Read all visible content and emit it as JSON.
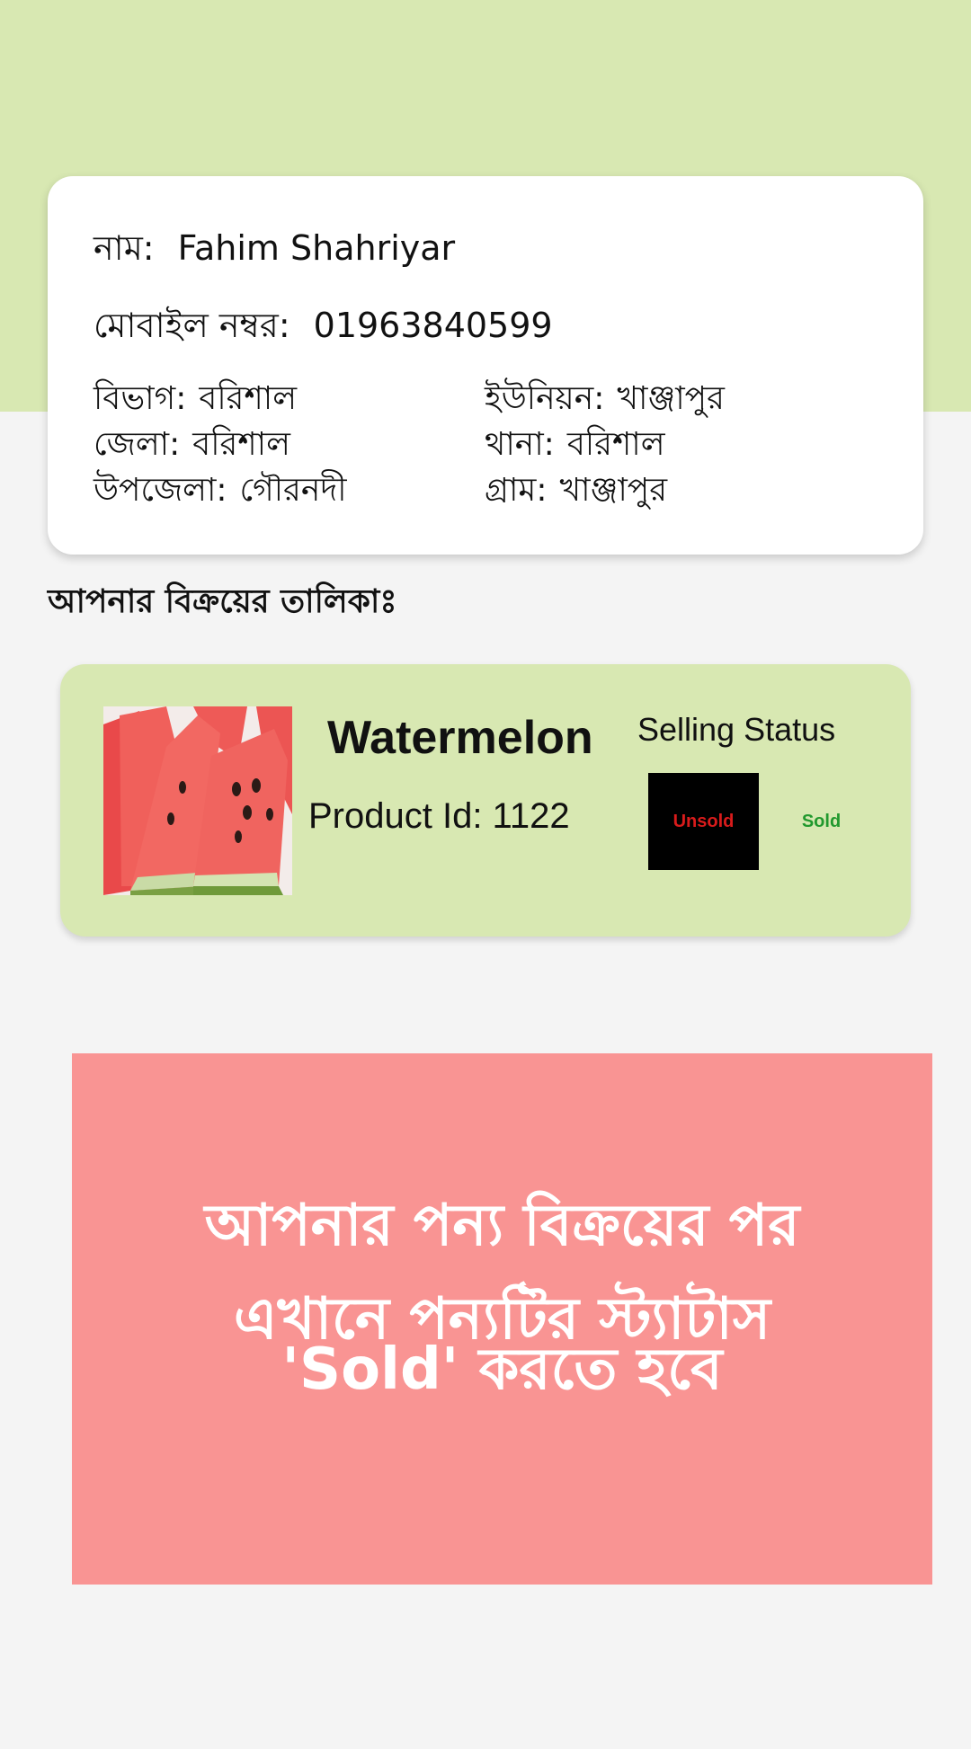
{
  "colors": {
    "header_band": "#d8e8b2",
    "card_background": "#ffffff",
    "product_card": "#d8e8b2",
    "unsold_button_bg": "#000000",
    "unsold_text": "#d81b1b",
    "sold_text": "#22992e",
    "notice_banner": "#f99493",
    "notice_text": "#ffffff"
  },
  "profile": {
    "name_label": "নাম:",
    "name_value": "Fahim Shahriyar",
    "mobile_label": "মোবাইল নম্বর:",
    "mobile_value": "01963840599",
    "division_label": "বিভাগ:",
    "division_value": "বরিশাল",
    "union_label": "ইউনিয়ন:",
    "union_value": "খাঞ্জাপুর",
    "district_label": "জেলা:",
    "district_value": "বরিশাল",
    "thana_label": "থানা:",
    "thana_value": "বরিশাল",
    "upazila_label": "উপজেলা:",
    "upazila_value": "গৌরনদী",
    "village_label": "গ্রাম:",
    "village_value": "খাঞ্জাপুর"
  },
  "sales_heading": "আপনার বিক্রয়ের তালিকাঃ",
  "product": {
    "image_icon": "watermelon-slices-photo",
    "name": "Watermelon",
    "id_text": "Product Id: 1122",
    "status_title": "Selling Status",
    "unsold_label": "Unsold",
    "sold_label": "Sold"
  },
  "notice": {
    "line1": "আপনার পন্য বিক্রয়ের পর",
    "line2": "এখানে পন্যটির স্ট্যাটাস",
    "line3": "'Sold' করতে হবে"
  }
}
